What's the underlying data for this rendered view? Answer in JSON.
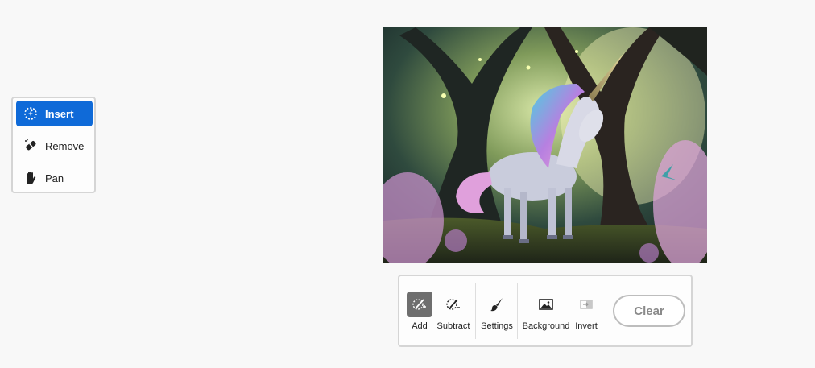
{
  "tools": {
    "items": [
      {
        "label": "Insert",
        "icon": "insert-icon",
        "active": true
      },
      {
        "label": "Remove",
        "icon": "remove-icon",
        "active": false
      },
      {
        "label": "Pan",
        "icon": "pan-icon",
        "active": false
      }
    ]
  },
  "canvas": {
    "subject": "unicorn in an enchanted forest"
  },
  "toolbar": {
    "add_label": "Add",
    "subtract_label": "Subtract",
    "settings_label": "Settings",
    "background_label": "Background",
    "invert_label": "Invert",
    "clear_label": "Clear"
  },
  "colors": {
    "accent": "#0f6ad8",
    "selected": "#6e6e6e"
  }
}
